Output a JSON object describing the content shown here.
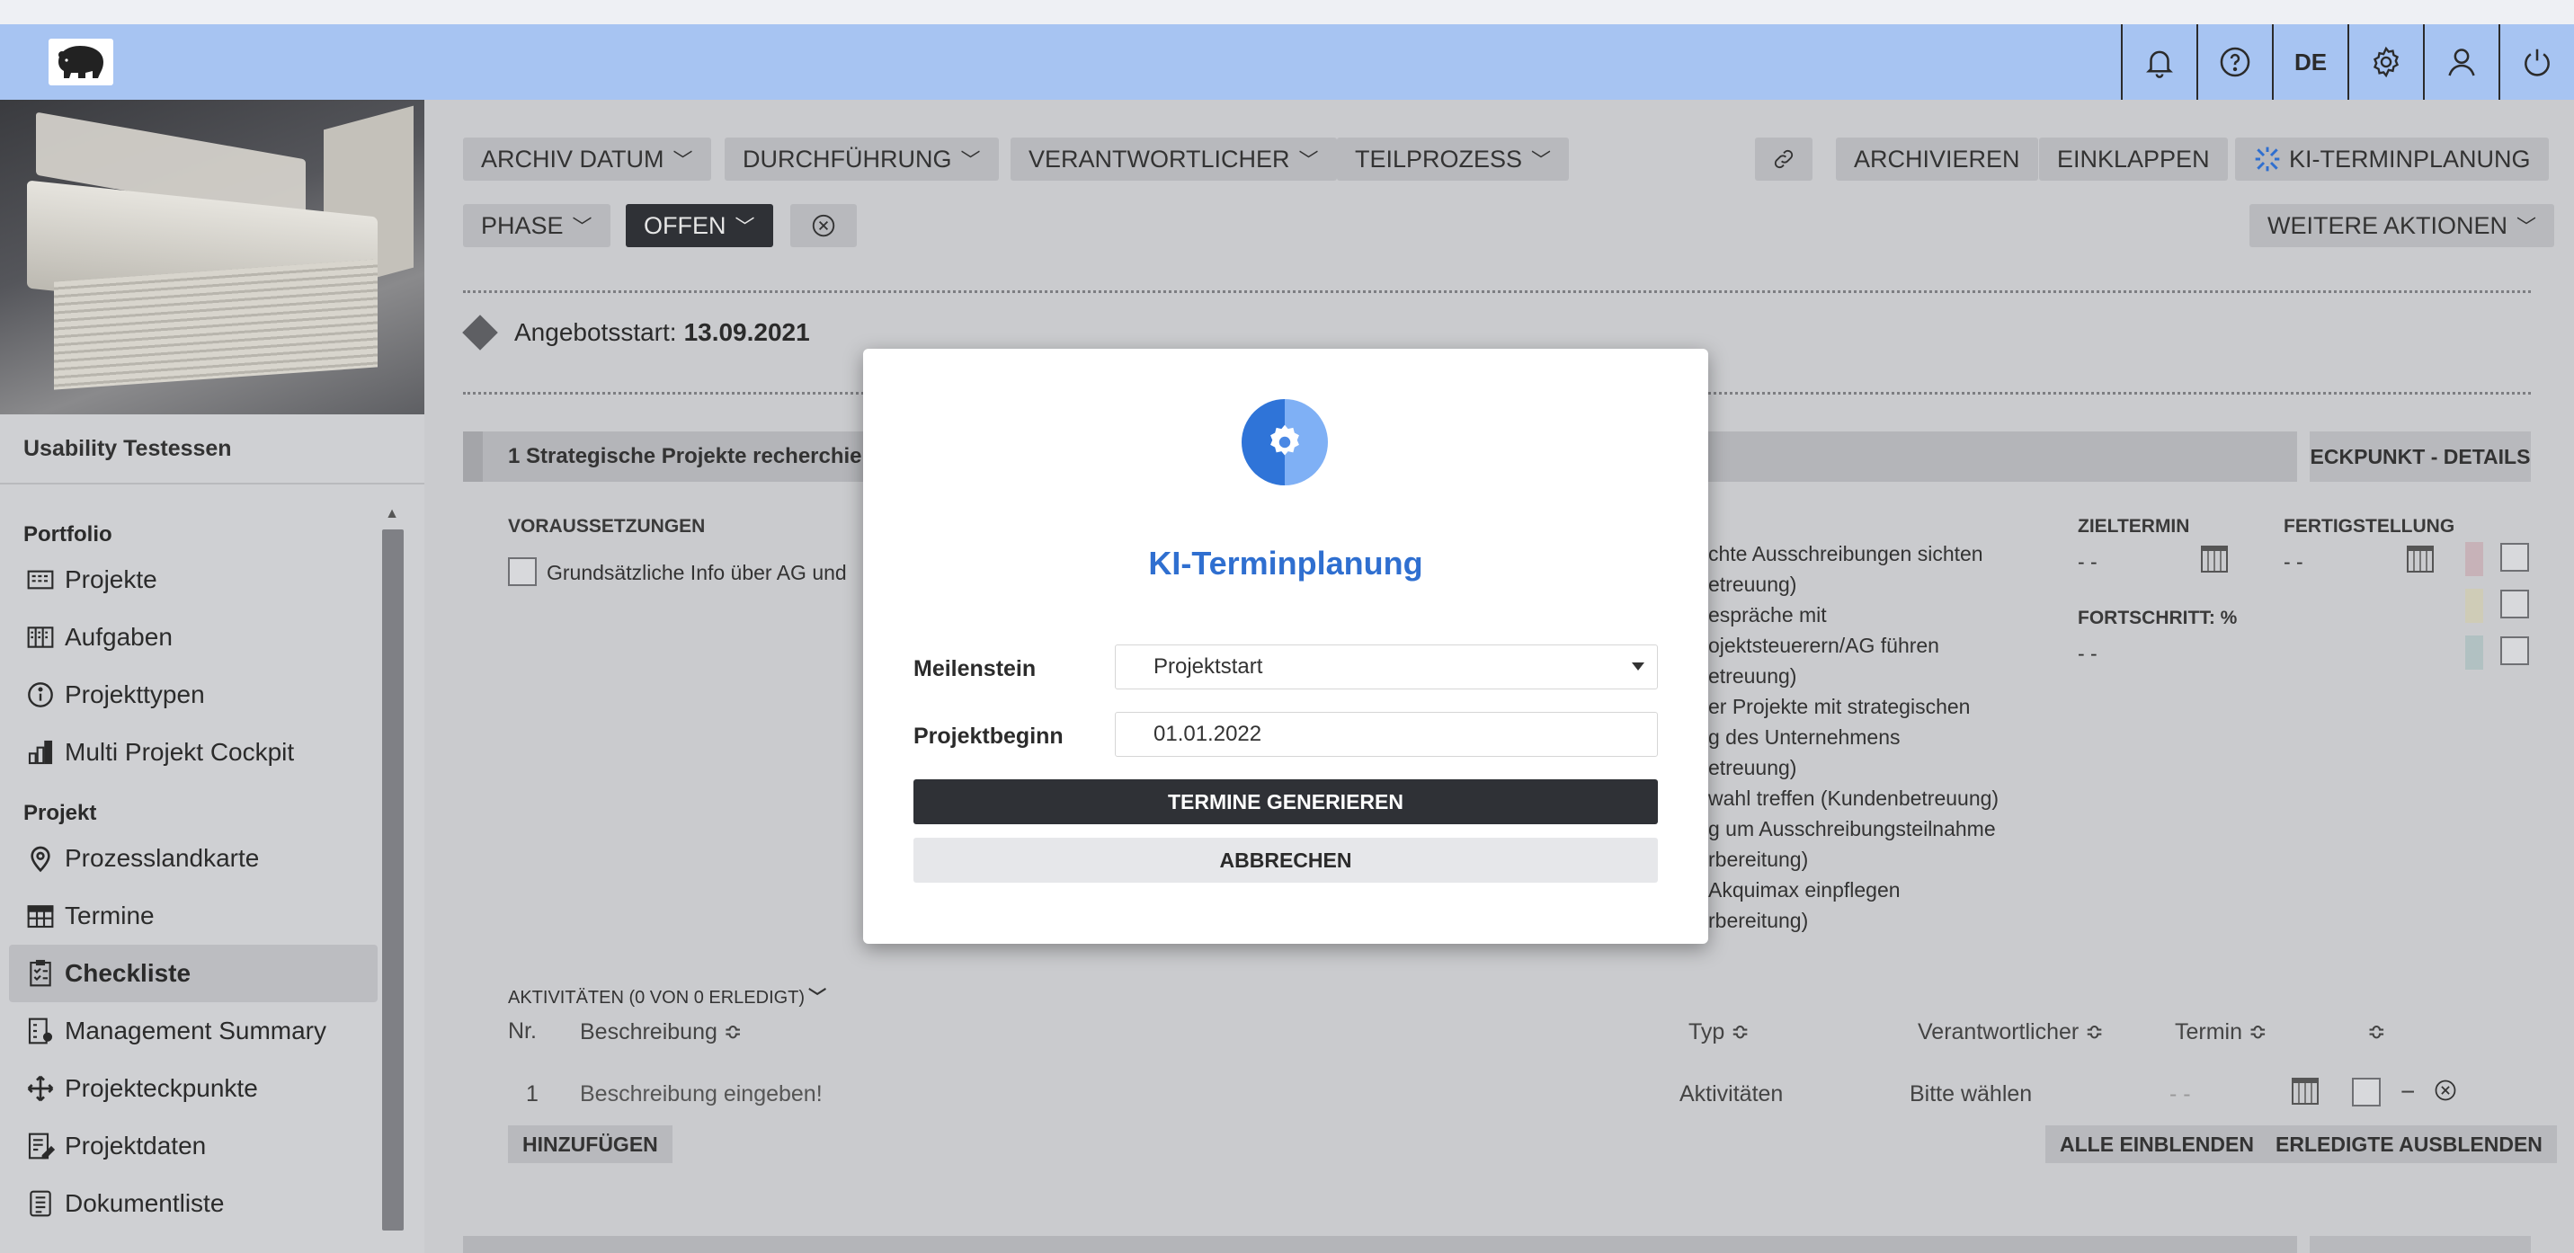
{
  "topbar": {
    "language": "DE",
    "icons": [
      "bell-icon",
      "help-icon",
      "language-toggle",
      "settings-icon",
      "user-icon",
      "power-icon"
    ]
  },
  "sidebar": {
    "project_name": "Usability Testessen",
    "portfolio_heading": "Portfolio",
    "portfolio_items": [
      {
        "label": "Projekte",
        "icon": "projects-icon"
      },
      {
        "label": "Aufgaben",
        "icon": "tasks-icon"
      },
      {
        "label": "Projekttypen",
        "icon": "info-icon"
      },
      {
        "label": "Multi Projekt Cockpit",
        "icon": "chart-icon"
      }
    ],
    "projekt_heading": "Projekt",
    "projekt_items": [
      {
        "label": "Prozesslandkarte",
        "icon": "pin-icon"
      },
      {
        "label": "Termine",
        "icon": "calendar-icon"
      },
      {
        "label": "Checkliste",
        "icon": "checklist-icon",
        "active": true
      },
      {
        "label": "Management Summary",
        "icon": "summary-icon"
      },
      {
        "label": "Projekteckpunkte",
        "icon": "milestone-icon"
      },
      {
        "label": "Projektdaten",
        "icon": "edit-doc-icon"
      },
      {
        "label": "Dokumentliste",
        "icon": "doc-list-icon"
      }
    ]
  },
  "filters": {
    "archiv_datum": "ARCHIV DATUM",
    "durchfuehrung": "DURCHFÜHRUNG",
    "verantwortlicher": "VERANTWORTLICHER",
    "teilprozess": "TEILPROZESS",
    "phase": "PHASE",
    "offen": "OFFEN"
  },
  "actions": {
    "archivieren": "ARCHIVIEREN",
    "einklappen": "EINKLAPPEN",
    "ki_terminplanung": "KI-TERMINPLANUNG",
    "weitere_aktionen": "WEITERE AKTIONEN"
  },
  "milestone": {
    "label": "Angebotsstart:",
    "date": "13.09.2021"
  },
  "section": {
    "title": "1 Strategische Projekte recherchier",
    "details_button": "ECKPUNKT - DETAILS",
    "voraussetzungen": "VORAUSSETZUNGEN",
    "voraussetzung_item": "Grundsätzliche Info über AG und",
    "zieltermin": "ZIELTERMIN",
    "fertigstellung": "FERTIGSTELLUNG",
    "fortschritt": "FORTSCHRITT: %",
    "placeholder_dash": "- -",
    "ergebnisse": [
      "chte Ausschreibungen sichten",
      "etreuung)",
      "espräche mit",
      "ojektsteuerern/AG führen",
      "etreuung)",
      "er Projekte mit strategischen",
      "g des Unternehmens",
      "etreuung)",
      "wahl treffen (Kundenbetreuung)",
      "g um Ausschreibungsteilnahme",
      "rbereitung)",
      "Akquimax einpflegen",
      "rbereitung)"
    ]
  },
  "activities": {
    "heading": "AKTIVITÄTEN (0 VON 0 ERLEDIGT)",
    "col_nr": "Nr.",
    "col_beschreibung": "Beschreibung ≎",
    "col_typ": "Typ ≎",
    "col_verantwortlicher": "Verantwortlicher ≎",
    "col_termin": "Termin ≎",
    "col_extra": "≎",
    "row": {
      "nr": "1",
      "beschreibung": "Beschreibung eingeben!",
      "typ": "Aktivitäten",
      "verantwortlicher": "Bitte wählen",
      "termin": "- -"
    },
    "hinzufuegen": "HINZUFÜGEN",
    "alle_einblenden": "ALLE EINBLENDEN",
    "erledigte_ausblenden": "ERLEDIGTE AUSBLENDEN"
  },
  "modal": {
    "title": "KI-Terminplanung",
    "meilenstein_label": "Meilenstein",
    "meilenstein_value": "Projektstart",
    "projektbeginn_label": "Projektbeginn",
    "projektbeginn_value": "01.01.2022",
    "primary_button": "TERMINE GENERIEREN",
    "secondary_button": "ABBRECHEN",
    "accent_color": "#2f6fd0"
  }
}
